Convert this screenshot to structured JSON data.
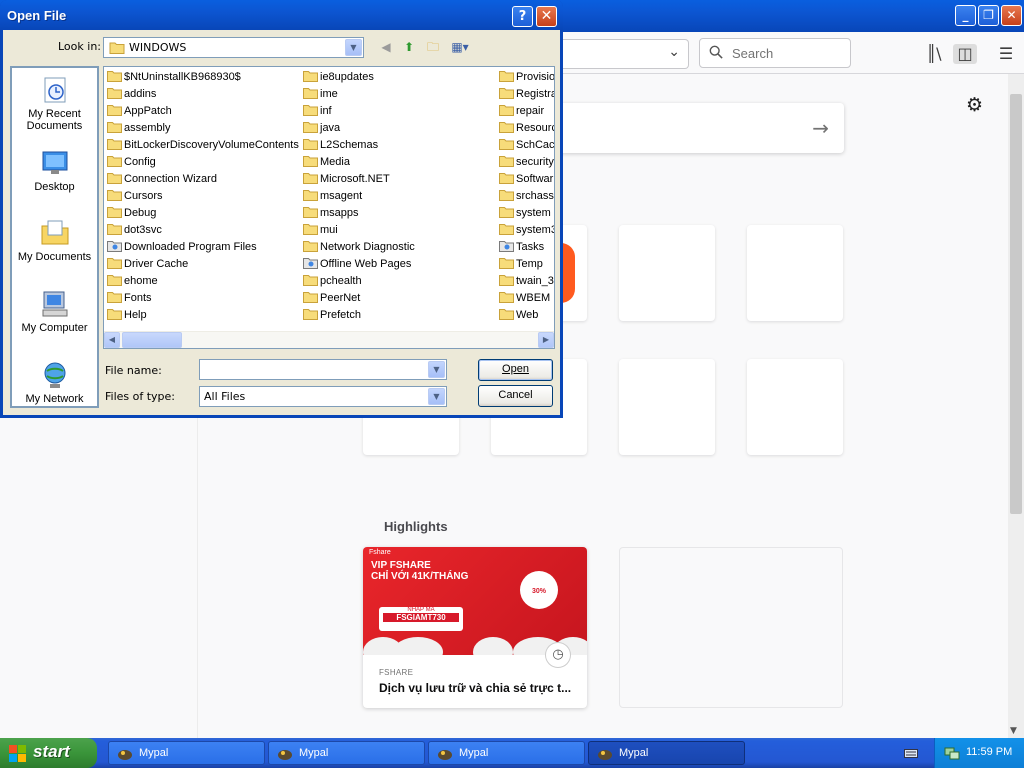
{
  "browser": {
    "search_placeholder": "Search",
    "highlights_title": "Highlights",
    "card": {
      "brand": "Fshare",
      "headline1": "VIP FSHARE",
      "headline2": "CHỈ VỚI 41K/THÁNG",
      "promo_label": "NHẬP MÃ",
      "promo_code": "FSGIAMT730",
      "badge": "30%",
      "site": "FSHARE",
      "description": "Dịch vụ lưu trữ và chia sẻ trực t..."
    }
  },
  "dialog": {
    "title": "Open File",
    "help_label": "?",
    "close_label": "✕",
    "look_in_label": "Look in:",
    "look_in_value": "WINDOWS",
    "places": [
      {
        "label1": "My Recent",
        "label2": "Documents",
        "icon": "recent-documents-icon"
      },
      {
        "label1": "Desktop",
        "label2": "",
        "icon": "desktop-icon"
      },
      {
        "label1": "My Documents",
        "label2": "",
        "icon": "my-documents-icon"
      },
      {
        "label1": "My Computer",
        "label2": "",
        "icon": "my-computer-icon"
      },
      {
        "label1": "My Network",
        "label2": "",
        "icon": "my-network-icon"
      }
    ],
    "files_col1": [
      "$NtUninstallKB968930$",
      "addins",
      "AppPatch",
      "assembly",
      "BitLockerDiscoveryVolumeContents",
      "Config",
      "Connection Wizard",
      "Cursors",
      "Debug",
      "dot3svc",
      "Downloaded Program Files",
      "Driver Cache",
      "ehome",
      "Fonts",
      "Help"
    ],
    "files_col2": [
      "ie8updates",
      "ime",
      "inf",
      "java",
      "L2Schemas",
      "Media",
      "Microsoft.NET",
      "msagent",
      "msapps",
      "mui",
      "Network Diagnostic",
      "Offline Web Pages",
      "pchealth",
      "PeerNet",
      "Prefetch"
    ],
    "files_col3": [
      "Provisio",
      "Registra",
      "repair",
      "Resourc",
      "SchCacl",
      "security",
      "Softwar",
      "srchass",
      "system",
      "system3",
      "Tasks",
      "Temp",
      "twain_3",
      "WBEM",
      "Web"
    ],
    "file_name_label": "File name:",
    "file_name_value": "",
    "file_type_label": "Files of type:",
    "file_type_value": "All Files",
    "open_label": "Open",
    "cancel_label": "Cancel"
  },
  "taskbar": {
    "start_label": "start",
    "tasks": [
      "Mypal",
      "Mypal",
      "Mypal",
      "Mypal"
    ],
    "time": "11:59 PM"
  }
}
